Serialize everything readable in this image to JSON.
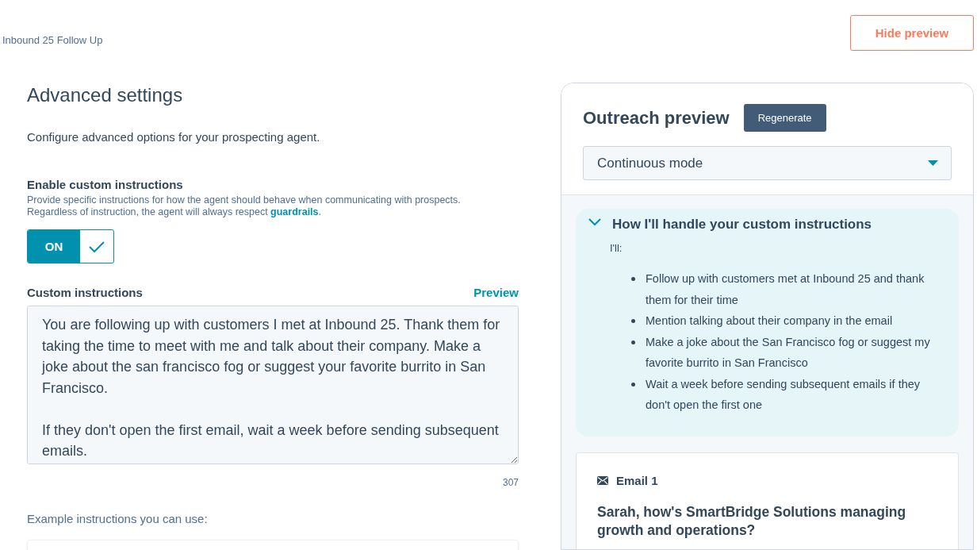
{
  "breadcrumb": "Inbound 25 Follow Up",
  "hide_preview_button": "Hide preview",
  "settings": {
    "title": "Advanced settings",
    "subtitle": "Configure advanced options for your prospecting agent.",
    "enable_label": "Enable custom instructions",
    "enable_help": "Provide specific instructions for how the agent should behave when communicating with prospects.\nRegardless of instruction, the agent will always respect ",
    "guardrails_link": "guardrails",
    "help_end": ".",
    "toggle": {
      "on": true,
      "label": "ON"
    },
    "instructions_label": "Custom instructions",
    "preview_link": "Preview",
    "instructions_value": "You are following up with customers I met at Inbound 25. Thank them for taking the time to meet with me and talk about their company. Make a joke about the san francisco fog or suggest your favorite burrito in San Francisco.\n\nIf they don't open the first email, wait a week before sending subsequent emails.",
    "char_count": "307",
    "examples_label": "Example instructions you can use:"
  },
  "preview": {
    "title": "Outreach preview",
    "regenerate_button": "Regenerate",
    "mode_select": "Continuous mode",
    "summary": {
      "expanded": true,
      "title": "How I'll handle your custom instructions",
      "intro": "I'll:",
      "items": [
        "Follow up with customers met at Inbound 25 and thank them for their time",
        "Mention talking about their company in the email",
        "Make a joke about the San Francisco fog or suggest my favorite burrito in San Francisco",
        "Wait a week before sending subsequent emails if they don't open the first one"
      ]
    },
    "email": {
      "label": "Email 1",
      "subject": "Sarah, how's SmartBridge Solutions managing growth and operations?"
    }
  }
}
